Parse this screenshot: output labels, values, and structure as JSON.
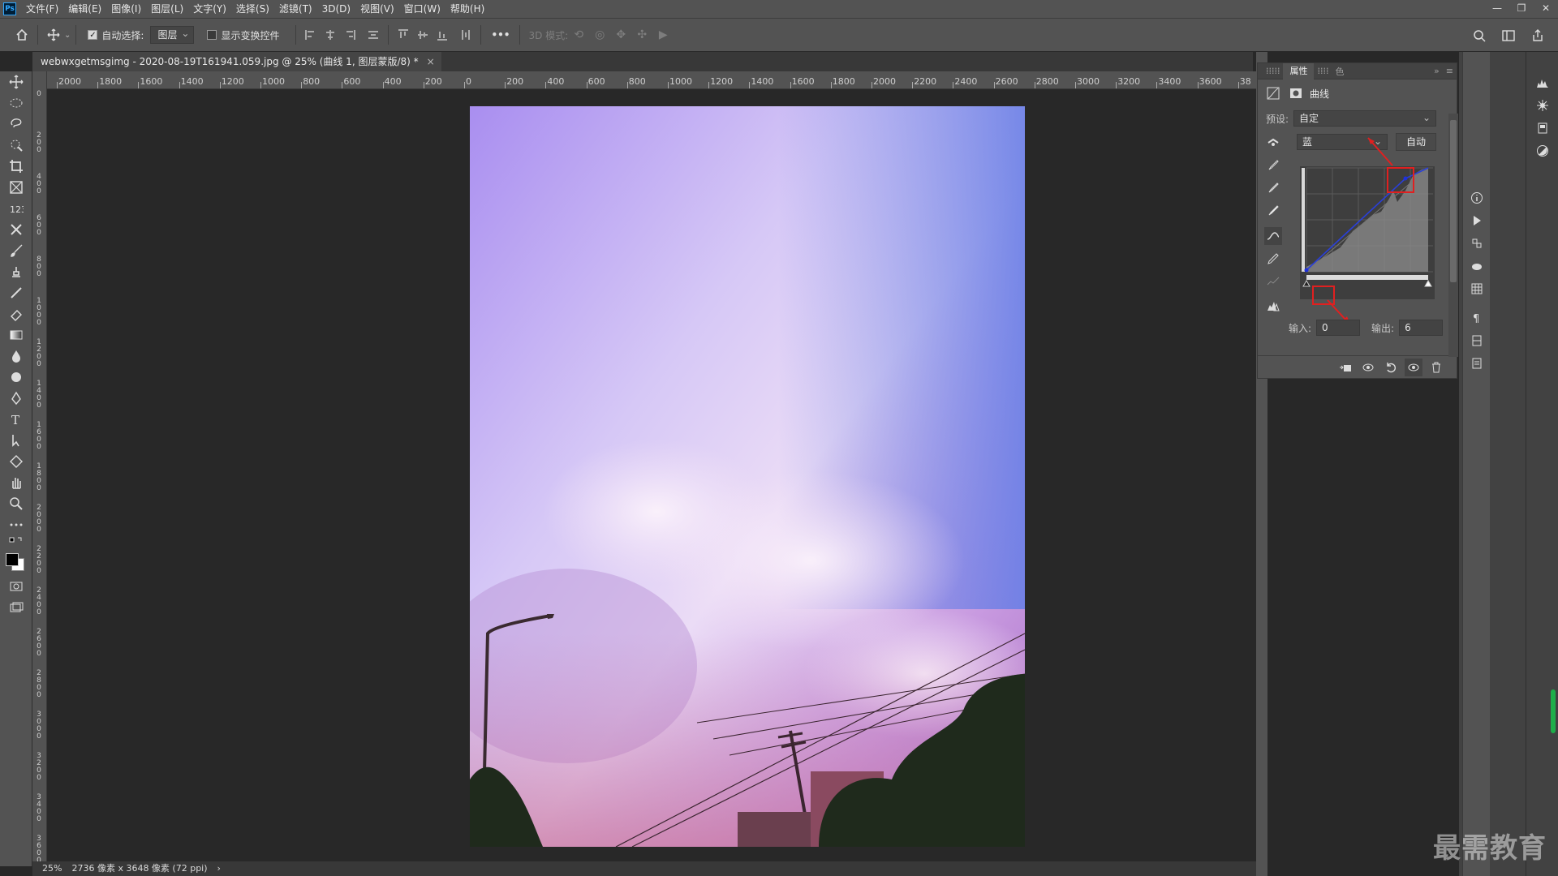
{
  "app": {
    "logo": "Ps"
  },
  "menu": [
    "文件(F)",
    "编辑(E)",
    "图像(I)",
    "图层(L)",
    "文字(Y)",
    "选择(S)",
    "滤镜(T)",
    "3D(D)",
    "视图(V)",
    "窗口(W)",
    "帮助(H)"
  ],
  "options": {
    "auto_select_label": "自动选择:",
    "auto_select_checked": true,
    "layer_dropdown": "图层",
    "show_transform_label": "显示变换控件",
    "show_transform_checked": false,
    "more": "•••",
    "mode_3d_label": "3D 模式:"
  },
  "document": {
    "tab_title": "webwxgetmsgimg - 2020-08-19T161941.059.jpg @ 25% (曲线 1, 图层蒙版/8) *",
    "close": "×"
  },
  "ruler": {
    "top_labels": [
      "2000",
      "1800",
      "1600",
      "1400",
      "1200",
      "1000",
      "800",
      "600",
      "400",
      "200",
      "0",
      "200",
      "400",
      "600",
      "800",
      "1000",
      "1200",
      "1400",
      "1600",
      "1800",
      "2000",
      "2200",
      "2400",
      "2600",
      "2800",
      "3000",
      "3200",
      "3400",
      "3600",
      "38"
    ],
    "left_labels": [
      "0",
      "2 0 0",
      "4 0 0",
      "6 0 0",
      "8 0 0",
      "1 0 0 0",
      "1 2 0 0",
      "1 4 0 0",
      "1 6 0 0",
      "1 8 0 0",
      "2 0 0 0",
      "2 2 0 0",
      "2 4 0 0",
      "2 6 0 0",
      "2 8 0 0",
      "3 0 0 0",
      "3 2 0 0",
      "3 4 0 0",
      "3 6 0 0"
    ]
  },
  "status": {
    "zoom": "25%",
    "doc_info": "2736 像素 x 3648 像素 (72 ppi)",
    "arrow": "›"
  },
  "properties": {
    "tab_label": "属性",
    "collapsed_tabs": [
      "色"
    ],
    "adjustment_label": "曲线",
    "preset_label": "预设:",
    "preset_value": "自定",
    "channel_value": "蓝",
    "auto_button": "自动",
    "input_label": "输入:",
    "input_value": "0",
    "output_label": "输出:",
    "output_value": "6",
    "channel_color": "#2233cc"
  },
  "watermark": "最需教育"
}
